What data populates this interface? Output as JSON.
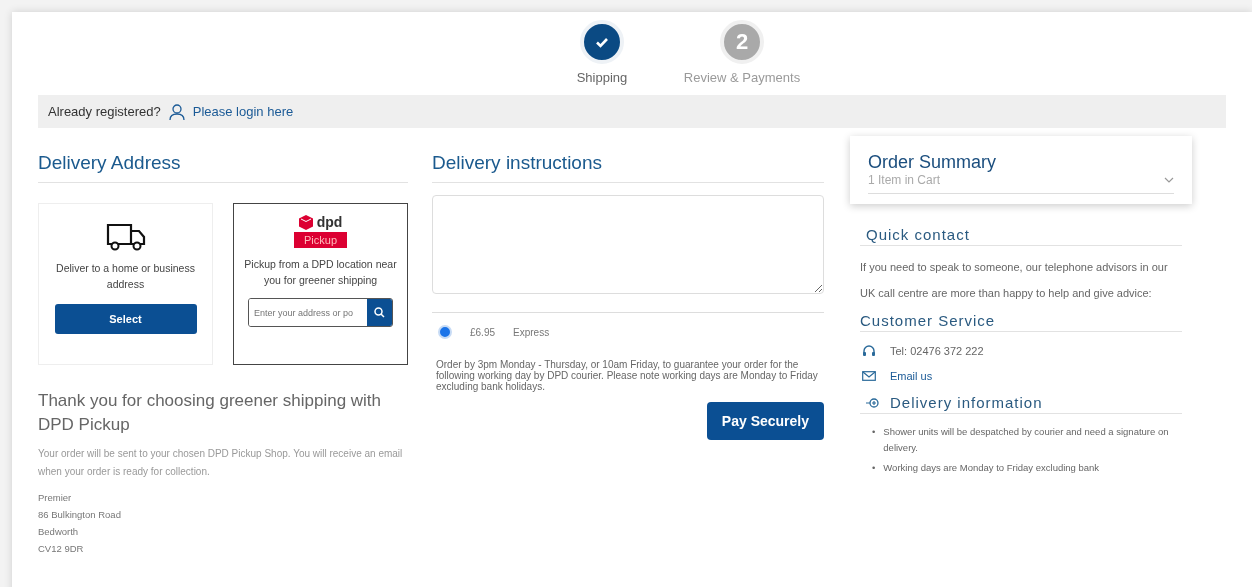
{
  "steps": [
    {
      "label": "Shipping",
      "completed": true
    },
    {
      "number": "2",
      "label": "Review & Payments",
      "completed": false
    }
  ],
  "login_bar": {
    "prompt": "Already registered?",
    "link": "Please login here"
  },
  "delivery_address": {
    "title": "Delivery Address",
    "options": [
      {
        "kind": "home",
        "text": "Deliver to a home or business address",
        "button": "Select",
        "selected": false
      },
      {
        "kind": "pickup",
        "logo_text": "dpd",
        "logo_badge": "Pickup",
        "text": "Pickup from a DPD location near you for greener shipping",
        "placeholder": "Enter your address or po",
        "selected": true
      }
    ],
    "thanks_title": "Thank you for choosing greener shipping with DPD Pickup",
    "thanks_text": "Your order will be sent to your chosen DPD Pickup Shop. You will receive an email when your order is ready for collection.",
    "address_lines": [
      "Premier",
      "86 Bulkington Road",
      "Bedworth",
      "CV12 9DR"
    ]
  },
  "delivery_instructions": {
    "title": "Delivery instructions",
    "shipping_methods": [
      {
        "price": "£6.95",
        "name": "Express",
        "selected": true
      }
    ],
    "note": "Order by 3pm Monday - Thursday, or 10am Friday, to guarantee your order for the following working day by DPD courier. Please note working days are Monday to Friday excluding bank holidays.",
    "pay_button": "Pay Securely"
  },
  "order_summary": {
    "title": "Order Summary",
    "count": "1 Item in Cart",
    "expanded": false
  },
  "quick_contact": {
    "title": "Quick contact",
    "text": "If you need to speak to someone, our telephone advisors in our UK call centre are more than happy to help and give advice:"
  },
  "customer_service": {
    "title": "Customer Service",
    "phone": "Tel: 02476 372 222",
    "email": "Email us"
  },
  "delivery_information": {
    "title": "Delivery information",
    "items": [
      {
        "marker": "•",
        "text": "Shower units will be despatched by courier and need a signature on delivery."
      },
      {
        "marker": "•",
        "text": "Working days are Monday to Friday excluding bank"
      }
    ]
  }
}
